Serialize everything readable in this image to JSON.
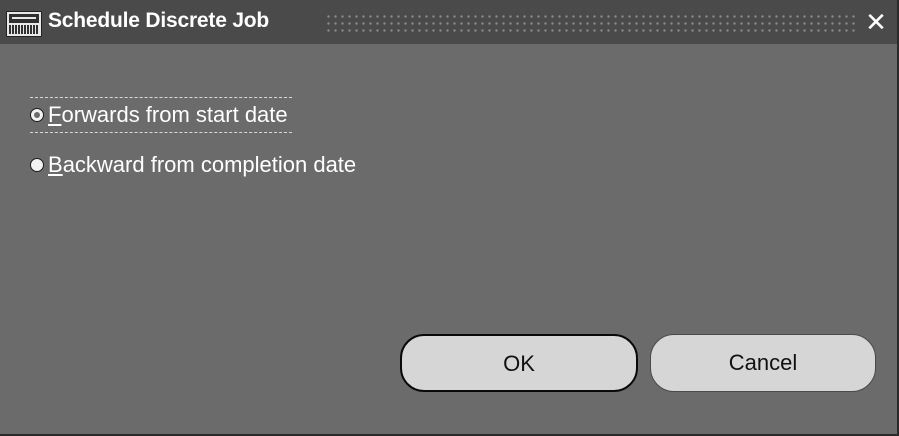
{
  "window": {
    "title": "Schedule Discrete Job",
    "app_icon": "oracle-applications-icon",
    "close_glyph": "✕"
  },
  "options": [
    {
      "mnemonic": "F",
      "rest": "orwards from start date",
      "selected": true
    },
    {
      "mnemonic": "B",
      "rest": "ackward from completion date",
      "selected": false
    }
  ],
  "buttons": {
    "ok_label": "OK",
    "cancel_label": "Cancel"
  },
  "colors": {
    "window_bg": "#6b6b6b",
    "titlebar_bg": "#4a4a4a",
    "button_bg": "#d6d6d6",
    "text": "#ffffff"
  }
}
